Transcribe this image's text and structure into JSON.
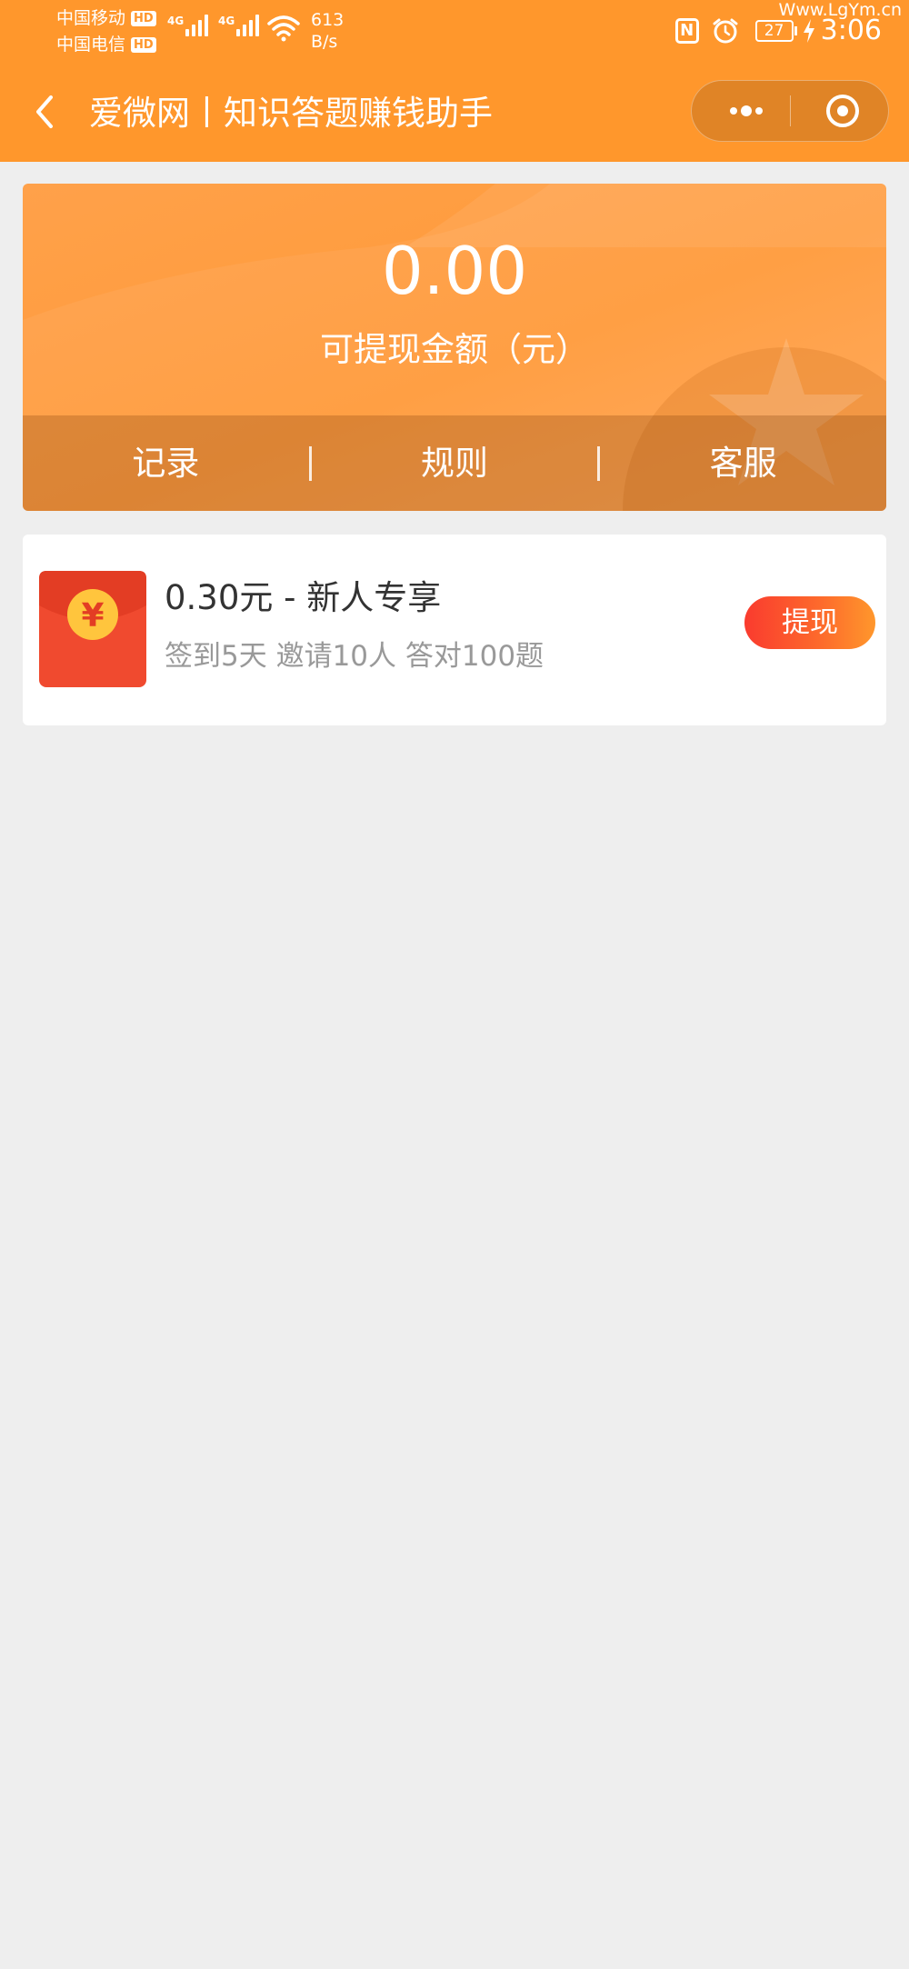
{
  "status_bar": {
    "carrier_1": "中国移动",
    "carrier_2": "中国电信",
    "hd_badge": "HD",
    "network_tag": "4G",
    "speed_value": "613",
    "speed_unit": "B/s",
    "nfc": "N",
    "battery": "27",
    "time": "3:06",
    "watermark": "Www.LgYm.cn"
  },
  "nav": {
    "title": "爱微网丨知识答题赚钱助手",
    "icons": {
      "back": "chevron-left-icon",
      "more": "more-dots-icon",
      "close": "target-icon"
    }
  },
  "balance_card": {
    "amount": "0.00",
    "label": "可提现金额（元）",
    "actions": [
      {
        "label": "记录"
      },
      {
        "label": "规则"
      },
      {
        "label": "客服"
      }
    ]
  },
  "reward_item": {
    "title": "0.30元 - 新人专享",
    "description": "签到5天 邀请10人 答对100题",
    "button": "提现",
    "envelope_symbol": "¥"
  },
  "colors": {
    "brand_orange": "#ff972c",
    "page_background": "#eeeeee",
    "button_red": "#fa3b2e",
    "envelope_red": "#f04a2f",
    "coin_yellow": "#ffc53d"
  }
}
